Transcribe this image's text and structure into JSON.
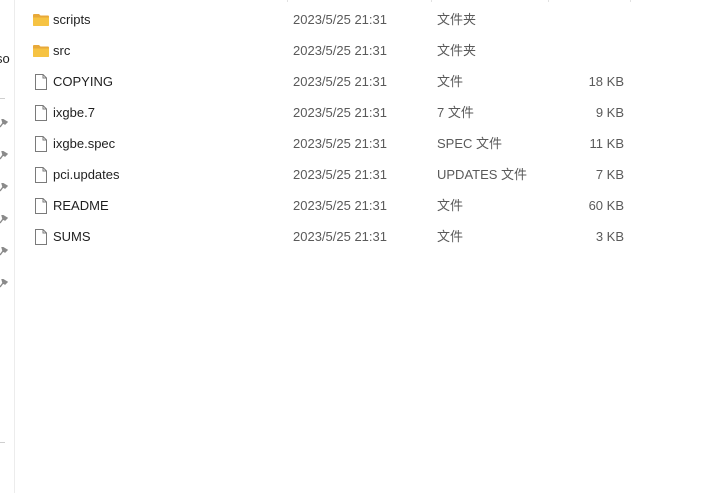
{
  "nav": {
    "cut_label": "so"
  },
  "files": [
    {
      "name": "scripts",
      "date": "2023/5/25 21:31",
      "type": "文件夹",
      "size": "",
      "icon": "folder-icon"
    },
    {
      "name": "src",
      "date": "2023/5/25 21:31",
      "type": "文件夹",
      "size": "",
      "icon": "folder-icon"
    },
    {
      "name": "COPYING",
      "date": "2023/5/25 21:31",
      "type": "文件",
      "size": "18 KB",
      "icon": "file-icon"
    },
    {
      "name": "ixgbe.7",
      "date": "2023/5/25 21:31",
      "type": "7 文件",
      "size": "9 KB",
      "icon": "file-icon"
    },
    {
      "name": "ixgbe.spec",
      "date": "2023/5/25 21:31",
      "type": "SPEC 文件",
      "size": "11 KB",
      "icon": "file-icon"
    },
    {
      "name": "pci.updates",
      "date": "2023/5/25 21:31",
      "type": "UPDATES 文件",
      "size": "7 KB",
      "icon": "file-icon"
    },
    {
      "name": "README",
      "date": "2023/5/25 21:31",
      "type": "文件",
      "size": "60 KB",
      "icon": "file-icon"
    },
    {
      "name": "SUMS",
      "date": "2023/5/25 21:31",
      "type": "文件",
      "size": "3 KB",
      "icon": "file-icon"
    }
  ],
  "colors": {
    "folder": "#f6c343",
    "folder_back": "#e8a93a",
    "file_outline": "#7a7a7a",
    "pin": "#8a8a8a"
  }
}
